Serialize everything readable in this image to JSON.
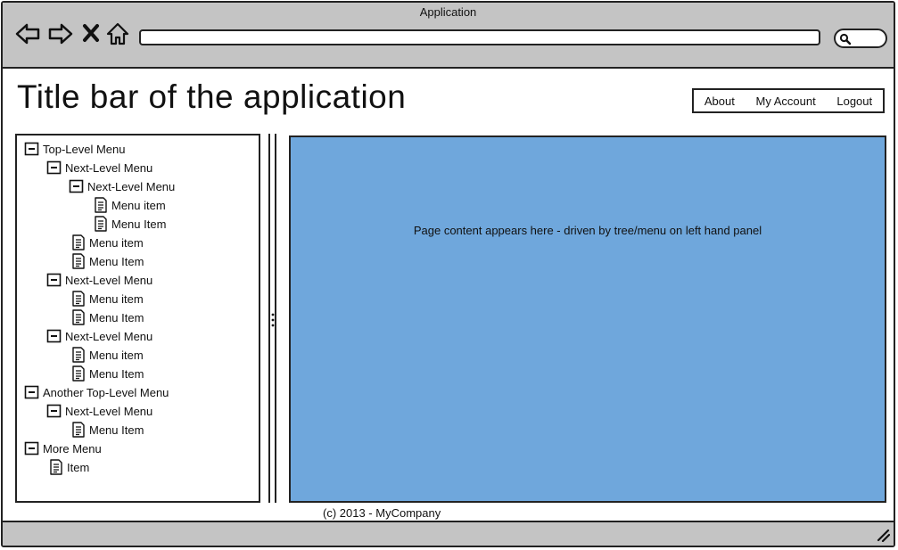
{
  "window": {
    "title": "Application"
  },
  "browser": {
    "back_icon": "back-arrow-icon",
    "forward_icon": "forward-arrow-icon",
    "stop_icon": "stop-x-icon",
    "home_icon": "home-icon",
    "search_icon": "search-icon"
  },
  "header": {
    "title": "Title bar of the application",
    "links": [
      "About",
      "My Account",
      "Logout"
    ]
  },
  "tree": [
    {
      "label": "Top-Level Menu",
      "type": "folder",
      "level": 0
    },
    {
      "label": "Next-Level Menu",
      "type": "folder",
      "level": 1
    },
    {
      "label": "Next-Level Menu",
      "type": "folder",
      "level": 2
    },
    {
      "label": "Menu item",
      "type": "leaf",
      "level": 3
    },
    {
      "label": "Menu Item",
      "type": "leaf",
      "level": 3
    },
    {
      "label": "Menu item",
      "type": "leaf",
      "level": 2
    },
    {
      "label": "Menu Item",
      "type": "leaf",
      "level": 2
    },
    {
      "label": "Next-Level Menu",
      "type": "folder",
      "level": 1
    },
    {
      "label": "Menu item",
      "type": "leaf",
      "level": 2
    },
    {
      "label": "Menu Item",
      "type": "leaf",
      "level": 2
    },
    {
      "label": "Next-Level Menu",
      "type": "folder",
      "level": 1
    },
    {
      "label": "Menu item",
      "type": "leaf",
      "level": 2
    },
    {
      "label": "Menu Item",
      "type": "leaf",
      "level": 2
    },
    {
      "label": "Another Top-Level Menu",
      "type": "folder",
      "level": 0
    },
    {
      "label": "Next-Level Menu",
      "type": "folder",
      "level": 1
    },
    {
      "label": "Menu Item",
      "type": "leaf",
      "level": 2
    },
    {
      "label": "More Menu",
      "type": "folder",
      "level": 0
    },
    {
      "label": "Item",
      "type": "leaf",
      "level": 1
    }
  ],
  "content": {
    "text": "Page content appears here - driven by tree/menu on left hand panel"
  },
  "footer": {
    "text": "(c) 2013 - MyCompany"
  },
  "colors": {
    "chrome": "#c4c4c4",
    "content_bg": "#6fa7dc",
    "border": "#222222"
  }
}
